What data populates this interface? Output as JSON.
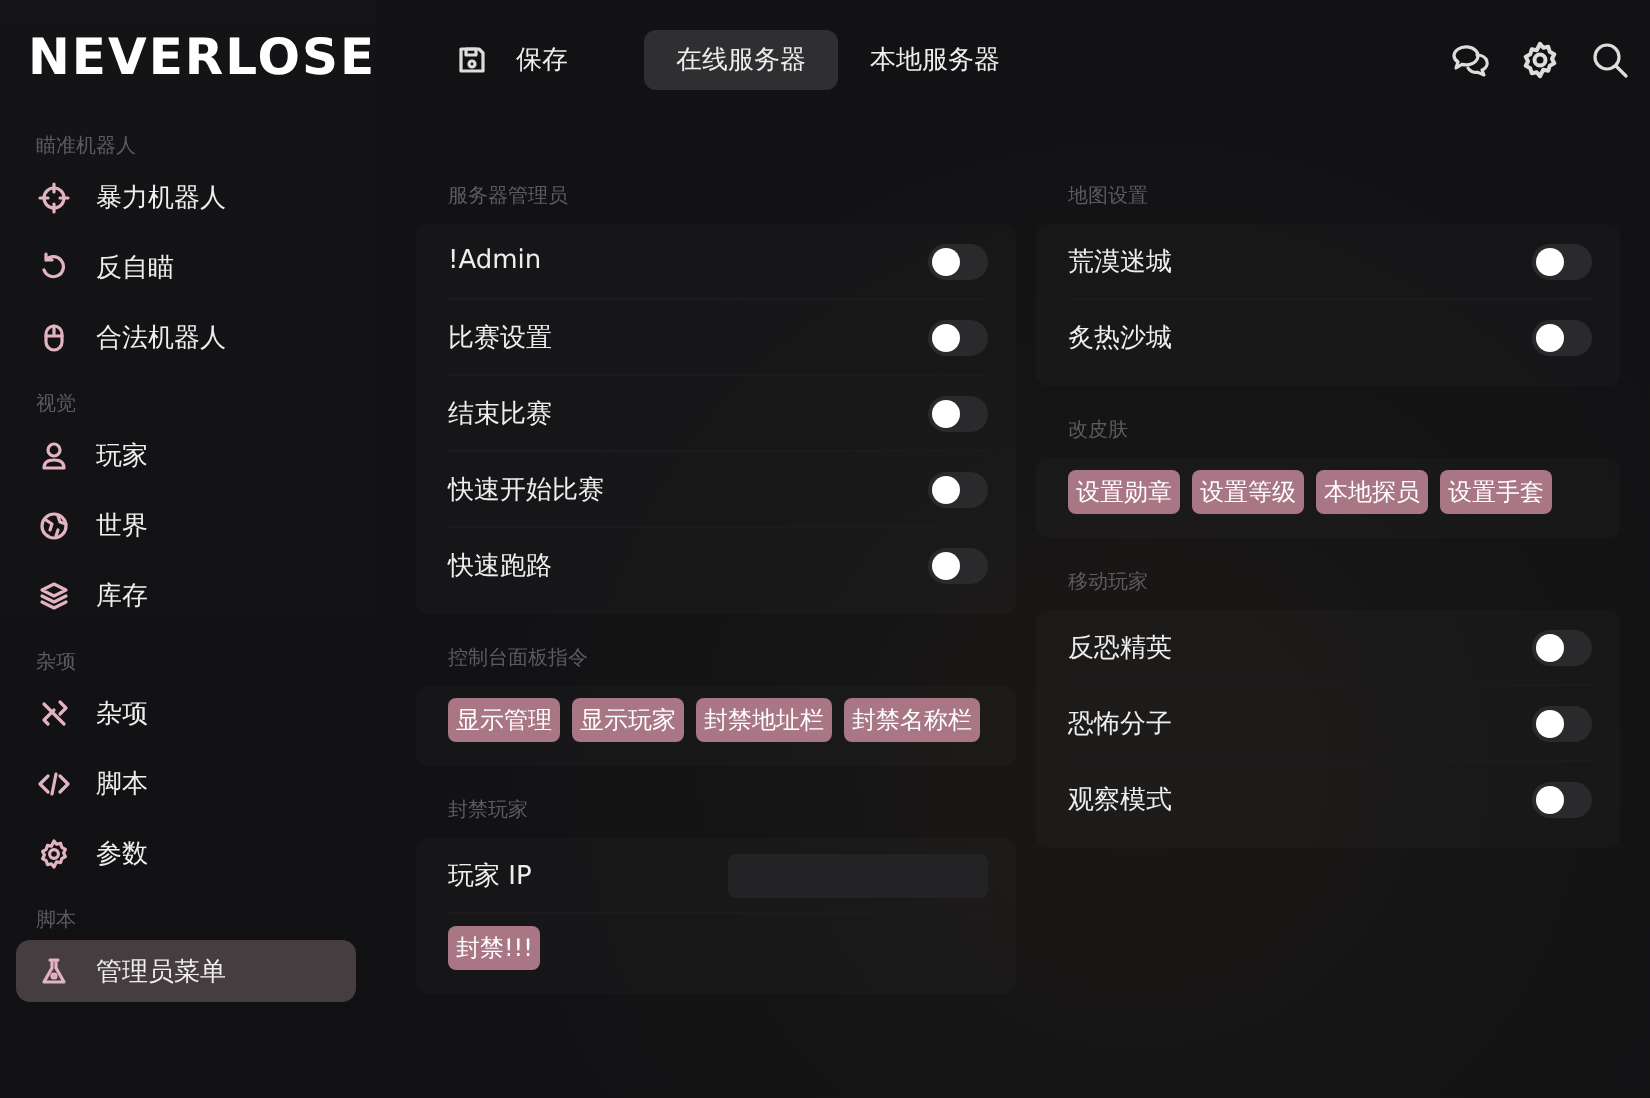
{
  "brand": "NEVERLOSE",
  "sidebar": {
    "sections": [
      {
        "title": "瞄准机器人",
        "items": [
          {
            "label": "暴力机器人",
            "selected": false
          },
          {
            "label": "反自瞄",
            "selected": false
          },
          {
            "label": "合法机器人",
            "selected": false
          }
        ]
      },
      {
        "title": "视觉",
        "items": [
          {
            "label": "玩家",
            "selected": false
          },
          {
            "label": "世界",
            "selected": false
          },
          {
            "label": "库存",
            "selected": false
          }
        ]
      },
      {
        "title": "杂项",
        "items": [
          {
            "label": "杂项",
            "selected": false
          },
          {
            "label": "脚本",
            "selected": false
          },
          {
            "label": "参数",
            "selected": false
          }
        ]
      },
      {
        "title": "脚本",
        "items": [
          {
            "label": "管理员菜单",
            "selected": true
          }
        ]
      }
    ]
  },
  "topbar": {
    "save": "保存",
    "tabs": [
      {
        "label": "在线服务器",
        "selected": true
      },
      {
        "label": "本地服务器",
        "selected": false
      }
    ]
  },
  "columns": [
    [
      {
        "title": "服务器管理员",
        "items": [
          {
            "kind": "toggle",
            "label": "!Admin",
            "on": false
          },
          {
            "kind": "toggle",
            "label": "比赛设置",
            "on": false
          },
          {
            "kind": "toggle",
            "label": "结束比赛",
            "on": false
          },
          {
            "kind": "toggle",
            "label": "快速开始比赛",
            "on": false
          },
          {
            "kind": "toggle",
            "label": "快速跑路",
            "on": false
          }
        ]
      },
      {
        "title": "控制台面板指令",
        "items": [
          {
            "kind": "buttons",
            "buttons": [
              "显示管理",
              "显示玩家",
              "封禁地址栏",
              "封禁名称栏"
            ]
          }
        ]
      },
      {
        "title": "封禁玩家",
        "items": [
          {
            "kind": "field",
            "label": "玩家 IP"
          },
          {
            "kind": "buttons",
            "buttons": [
              "封禁!!!"
            ]
          }
        ]
      }
    ],
    [
      {
        "title": "地图设置",
        "items": [
          {
            "kind": "toggle",
            "label": "荒漠迷城",
            "on": false
          },
          {
            "kind": "toggle",
            "label": "炙热沙城",
            "on": false
          }
        ]
      },
      {
        "title": "改皮肤",
        "items": [
          {
            "kind": "buttons",
            "buttons": [
              "设置勋章",
              "设置等级",
              "本地探员",
              "设置手套"
            ]
          }
        ]
      },
      {
        "title": "移动玩家",
        "items": [
          {
            "kind": "toggle",
            "label": "反恐精英",
            "on": false
          },
          {
            "kind": "toggle",
            "label": "恐怖分子",
            "on": false
          },
          {
            "kind": "toggle",
            "label": "观察模式",
            "on": false
          }
        ]
      }
    ]
  ]
}
